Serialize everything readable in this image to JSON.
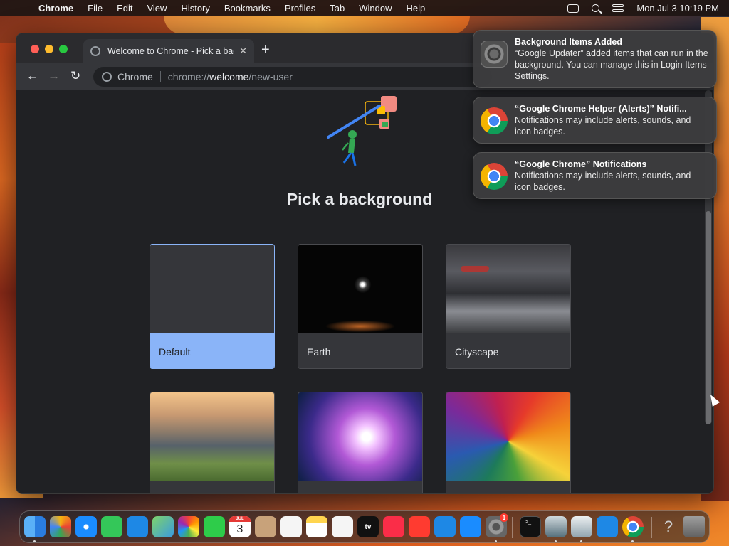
{
  "menubar": {
    "app_name": "Chrome",
    "items": [
      "File",
      "Edit",
      "View",
      "History",
      "Bookmarks",
      "Profiles",
      "Tab",
      "Window",
      "Help"
    ],
    "clock": "Mon Jul 3  10:19 PM"
  },
  "browser": {
    "tab": {
      "title": "Welcome to Chrome - Pick a background",
      "close": "✕"
    },
    "new_tab": "+",
    "toolbar": {
      "back": "←",
      "forward": "→",
      "reload": "↻"
    },
    "omnibox": {
      "site": "Chrome",
      "url_scheme": "chrome://",
      "url_host": "welcome",
      "url_path": "/new-user"
    }
  },
  "page": {
    "heading": "Pick a background",
    "backgrounds": [
      {
        "label": "Default",
        "selected": true
      },
      {
        "label": "Earth",
        "selected": false
      },
      {
        "label": "Cityscape",
        "selected": false
      },
      {
        "label": "",
        "selected": false
      },
      {
        "label": "",
        "selected": false
      },
      {
        "label": "",
        "selected": false
      }
    ]
  },
  "notifications": [
    {
      "title": "Background Items Added",
      "body": "“Google Updater” added items that can run in the background. You can manage this in Login Items Settings.",
      "icon": "settings-icon"
    },
    {
      "title": "“Google Chrome Helper (Alerts)” Notifi...",
      "body": "Notifications may include alerts, sounds, and icon badges.",
      "icon": "chrome-icon"
    },
    {
      "title": "“Google Chrome” Notifications",
      "body": "Notifications may include alerts, sounds, and icon badges.",
      "icon": "chrome-icon"
    }
  ],
  "dock": {
    "apps": [
      "finder-icon",
      "launchpad-icon",
      "safari-icon",
      "messages-icon",
      "mail-icon",
      "maps-icon",
      "photos-icon",
      "facetime-icon",
      "calendar-icon",
      "contacts-icon",
      "reminders-icon",
      "notes-icon",
      "freeform-icon",
      "tv-icon",
      "music-icon",
      "news-icon",
      "keynote-icon",
      "app-store-icon",
      "system-settings-icon",
      "terminal-icon",
      "preview-icon",
      "migration-icon",
      "screen-sharing-icon",
      "chrome-icon",
      "help-icon",
      "trash-icon"
    ],
    "calendar_month": "JUL",
    "calendar_day": "3",
    "tv_label": "tv",
    "settings_badge": "1",
    "terminal_prompt": ">_",
    "help_glyph": "?"
  },
  "colors": {
    "accent": "#8ab4f8",
    "page_bg": "#202124",
    "notification_bg": "#3c3c3e"
  }
}
